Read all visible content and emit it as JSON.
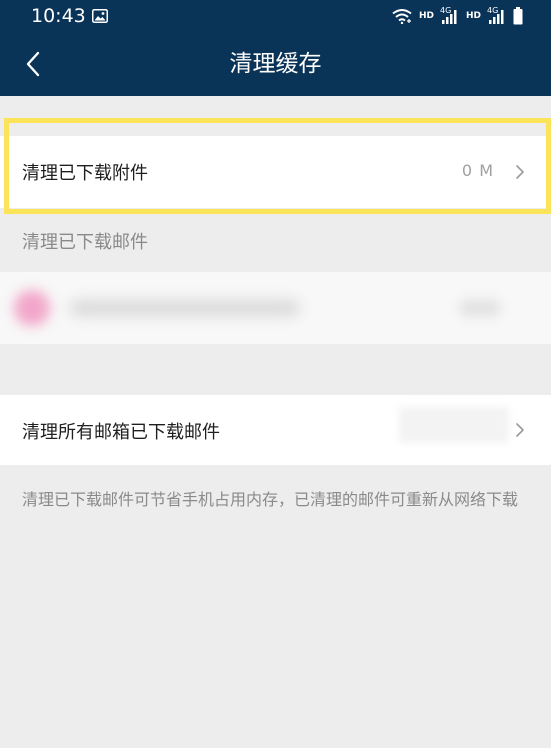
{
  "status_bar": {
    "time": "10:43",
    "hd_label_1": "HD",
    "network_label_1": "4G",
    "hd_label_2": "HD",
    "network_label_2": "4G",
    "icons": [
      "photo-icon",
      "wifi-icon",
      "signal-icon",
      "signal-icon",
      "battery-icon"
    ]
  },
  "nav": {
    "title": "清理缓存",
    "back_icon": "chevron-left-icon"
  },
  "rows": {
    "attachments": {
      "label": "清理已下载附件",
      "value": "0 M"
    },
    "all_mailboxes": {
      "label": "清理所有邮箱已下载邮件"
    }
  },
  "section": {
    "header": "清理已下载邮件"
  },
  "footnote": "清理已下载邮件可节省手机占用内存，已清理的邮件可重新从网络下载",
  "colors": {
    "nav_background": "#0a3358",
    "page_background": "#ededed",
    "highlight_border": "#fbe35a"
  }
}
